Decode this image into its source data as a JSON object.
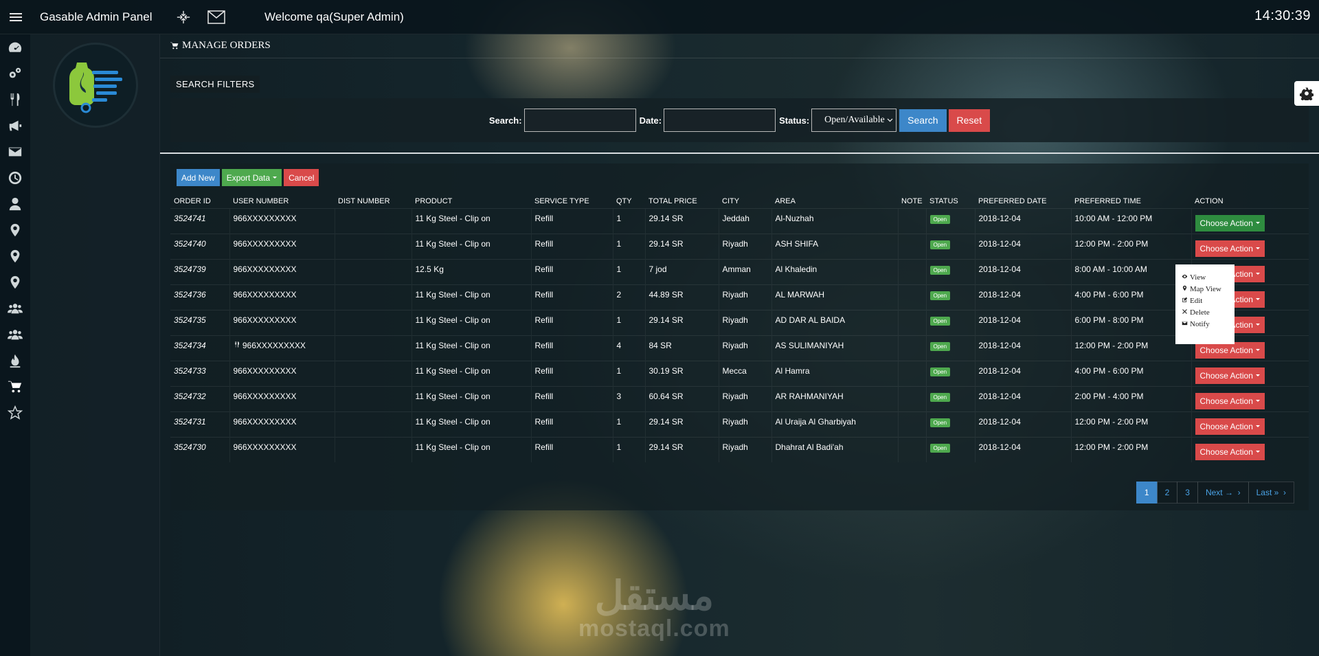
{
  "topbar": {
    "app_title": "Gasable Admin Panel",
    "welcome": "Welcome qa(Super Admin)",
    "clock": "14:30:39"
  },
  "rail": {
    "icons": [
      "dashboard-icon",
      "settings-cogs-icon",
      "restaurant-icon",
      "megaphone-icon",
      "envelope-icon",
      "clock-icon",
      "user-icon",
      "map-marker-icon",
      "map-marker-icon",
      "users-group-icon",
      "users-group-icon",
      "flame-icon",
      "shopping-cart-icon",
      "star-icon"
    ],
    "active_index": 12
  },
  "page": {
    "title": "MANAGE ORDERS",
    "filters_tag": "SEARCH FILTERS"
  },
  "filters": {
    "search_label": "Search:",
    "date_label": "Date:",
    "status_label": "Status:",
    "status_value": "Open/Available",
    "search_btn": "Search",
    "reset_btn": "Reset"
  },
  "toolbar": {
    "add_new": "Add New",
    "export": "Export Data",
    "cancel": "Cancel"
  },
  "table": {
    "columns": [
      "ORDER ID",
      "USER NUMBER",
      "DIST NUMBER",
      "PRODUCT",
      "SERVICE TYPE",
      "QTY",
      "TOTAL PRICE",
      "CITY",
      "AREA",
      "NOTE",
      "STATUS",
      "PREFERRED DATE",
      "PREFERRED TIME",
      "ACTION"
    ],
    "rows": [
      {
        "id": "3524741",
        "user": "966XXXXXXXXX",
        "dist": "",
        "product": "11 Kg Steel - Clip on",
        "service": "Refill",
        "qty": "1",
        "price": "29.14  SR",
        "city": "Jeddah",
        "area": "Al-Nuzhah",
        "note": "",
        "status": "Open",
        "date": "2018-12-04",
        "time": "10:00 AM - 12:00 PM",
        "action": "Choose Action",
        "user_icon": false
      },
      {
        "id": "3524740",
        "user": "966XXXXXXXXX",
        "dist": "",
        "product": "11 Kg Steel - Clip on",
        "service": "Refill",
        "qty": "1",
        "price": "29.14  SR",
        "city": "Riyadh",
        "area": "ASH SHIFA",
        "note": "",
        "status": "Open",
        "date": "2018-12-04",
        "time": "12:00 PM - 2:00 PM",
        "action": "Choose Action",
        "user_icon": false
      },
      {
        "id": "3524739",
        "user": "966XXXXXXXXX",
        "dist": "",
        "product": "12.5 Kg",
        "service": "Refill",
        "qty": "1",
        "price": "7  jod",
        "city": "Amman",
        "area": "Al Khaledin",
        "note": "",
        "status": "Open",
        "date": "2018-12-04",
        "time": "8:00 AM - 10:00 AM",
        "action": "Choose Action",
        "user_icon": false
      },
      {
        "id": "3524736",
        "user": "966XXXXXXXXX",
        "dist": "",
        "product": "11 Kg Steel - Clip on",
        "service": "Refill",
        "qty": "2",
        "price": "44.89  SR",
        "city": "Riyadh",
        "area": "AL MARWAH",
        "note": "",
        "status": "Open",
        "date": "2018-12-04",
        "time": "4:00 PM - 6:00 PM",
        "action": "Choose Action",
        "user_icon": false
      },
      {
        "id": "3524735",
        "user": "966XXXXXXXXX",
        "dist": "",
        "product": "11 Kg Steel - Clip on",
        "service": "Refill",
        "qty": "1",
        "price": "29.14  SR",
        "city": "Riyadh",
        "area": "AD DAR AL BAIDA",
        "note": "",
        "status": "Open",
        "date": "2018-12-04",
        "time": "6:00 PM - 8:00 PM",
        "action": "Choose Action",
        "user_icon": false
      },
      {
        "id": "3524734",
        "user": "966XXXXXXXXX",
        "dist": "",
        "product": "11 Kg Steel - Clip on",
        "service": "Refill",
        "qty": "4",
        "price": "84  SR",
        "city": "Riyadh",
        "area": "AS SULIMANIYAH",
        "note": "",
        "status": "Open",
        "date": "2018-12-04",
        "time": "12:00 PM - 2:00 PM",
        "action": "Choose Action",
        "user_icon": true
      },
      {
        "id": "3524733",
        "user": "966XXXXXXXXX",
        "dist": "",
        "product": "11 Kg Steel - Clip on",
        "service": "Refill",
        "qty": "1",
        "price": "30.19  SR",
        "city": "Mecca",
        "area": "Al Hamra",
        "note": "",
        "status": "Open",
        "date": "2018-12-04",
        "time": "4:00 PM - 6:00 PM",
        "action": "Choose Action",
        "user_icon": false
      },
      {
        "id": "3524732",
        "user": "966XXXXXXXXX",
        "dist": "",
        "product": "11 Kg Steel - Clip on",
        "service": "Refill",
        "qty": "3",
        "price": "60.64  SR",
        "city": "Riyadh",
        "area": "AR RAHMANIYAH",
        "note": "",
        "status": "Open",
        "date": "2018-12-04",
        "time": "2:00 PM - 4:00 PM",
        "action": "Choose Action",
        "user_icon": false
      },
      {
        "id": "3524731",
        "user": "966XXXXXXXXX",
        "dist": "",
        "product": "11 Kg Steel - Clip on",
        "service": "Refill",
        "qty": "1",
        "price": "29.14  SR",
        "city": "Riyadh",
        "area": "Al Uraija Al Gharbiyah",
        "note": "",
        "status": "Open",
        "date": "2018-12-04",
        "time": "12:00 PM - 2:00 PM",
        "action": "Choose Action",
        "user_icon": false
      },
      {
        "id": "3524730",
        "user": "966XXXXXXXXX",
        "dist": "",
        "product": "11 Kg Steel - Clip on",
        "service": "Refill",
        "qty": "1",
        "price": "29.14  SR",
        "city": "Riyadh",
        "area": "Dhahrat Al Badi'ah",
        "note": "",
        "status": "Open",
        "date": "2018-12-04",
        "time": "12:00 PM - 2:00 PM",
        "action": "Choose Action",
        "user_icon": false
      }
    ]
  },
  "dropdown": {
    "items": [
      {
        "label": "View",
        "icon": "eye-icon"
      },
      {
        "label": "Map View",
        "icon": "map-marker-icon"
      },
      {
        "label": "Edit",
        "icon": "edit-icon"
      },
      {
        "label": "Delete",
        "icon": "close-icon"
      },
      {
        "label": "Notify",
        "icon": "envelope-icon"
      }
    ]
  },
  "pagination": {
    "pages": [
      "1",
      "2",
      "3"
    ],
    "active": "1",
    "next": "Next →",
    "last": "Last »"
  },
  "watermark": {
    "arabic": "مستقل",
    "latin": "mostaql.com"
  },
  "colors": {
    "blue": "#3d87c9",
    "red": "#d94a4a",
    "green": "#4ea94e",
    "action_open": "#2e8c3f"
  }
}
